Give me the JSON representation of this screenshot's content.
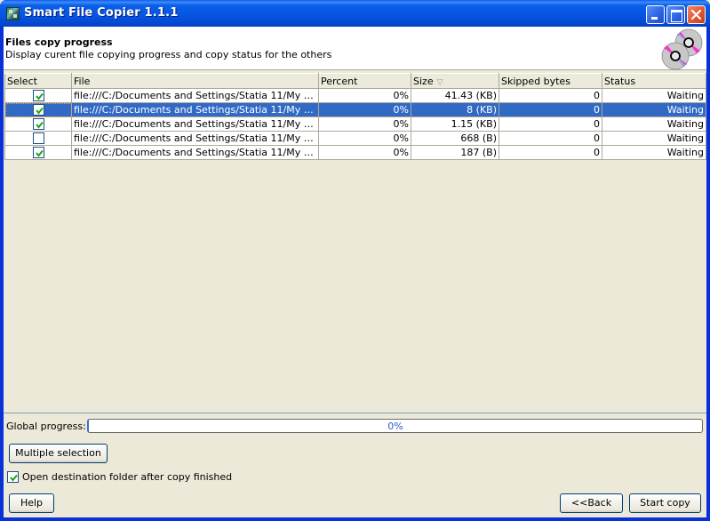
{
  "window": {
    "title": "Smart File Copier 1.1.1",
    "icon": "app-icon",
    "controls": [
      "minimize",
      "maximize",
      "close"
    ]
  },
  "header": {
    "title": "Files copy progress",
    "description": "Display curent file copying progress and copy status for the others",
    "icon": "cd-discs-icon"
  },
  "table": {
    "columns": [
      "Select",
      "File",
      "Percent",
      "Size",
      "Skipped bytes",
      "Status"
    ],
    "sort_column": "Size",
    "sort_icon": "sort-descending-icon",
    "rows": [
      {
        "selected_check": true,
        "file": "file:///C:/Documents and Settings/Statia 11/My Docum...",
        "percent": "0%",
        "size": "41.43 (KB)",
        "skipped": "0",
        "status": "Waiting",
        "highlighted": false
      },
      {
        "selected_check": true,
        "file": "file:///C:/Documents and Settings/Statia 11/My Docum...",
        "percent": "0%",
        "size": "8 (KB)",
        "skipped": "0",
        "status": "Waiting",
        "highlighted": true
      },
      {
        "selected_check": true,
        "file": "file:///C:/Documents and Settings/Statia 11/My Docum...",
        "percent": "0%",
        "size": "1.15 (KB)",
        "skipped": "0",
        "status": "Waiting",
        "highlighted": false
      },
      {
        "selected_check": false,
        "file": "file:///C:/Documents and Settings/Statia 11/My Docum...",
        "percent": "0%",
        "size": "668 (B)",
        "skipped": "0",
        "status": "Waiting",
        "highlighted": false
      },
      {
        "selected_check": true,
        "file": "file:///C:/Documents and Settings/Statia 11/My Docum...",
        "percent": "0%",
        "size": "187 (B)",
        "skipped": "0",
        "status": "Waiting",
        "highlighted": false
      }
    ]
  },
  "global_progress": {
    "label": "Global progress:",
    "value_percent": 0,
    "text": "0%"
  },
  "buttons": {
    "multiple_selection": "Multiple selection",
    "help": "Help",
    "back": "<<Back",
    "start_copy": "Start copy"
  },
  "options": {
    "open_destination_label": "Open destination folder after copy finished",
    "open_destination_checked": true
  },
  "colors": {
    "selection": "#316ac5",
    "titlebar": "#0554e2",
    "progress_text": "#2a5bc8"
  }
}
